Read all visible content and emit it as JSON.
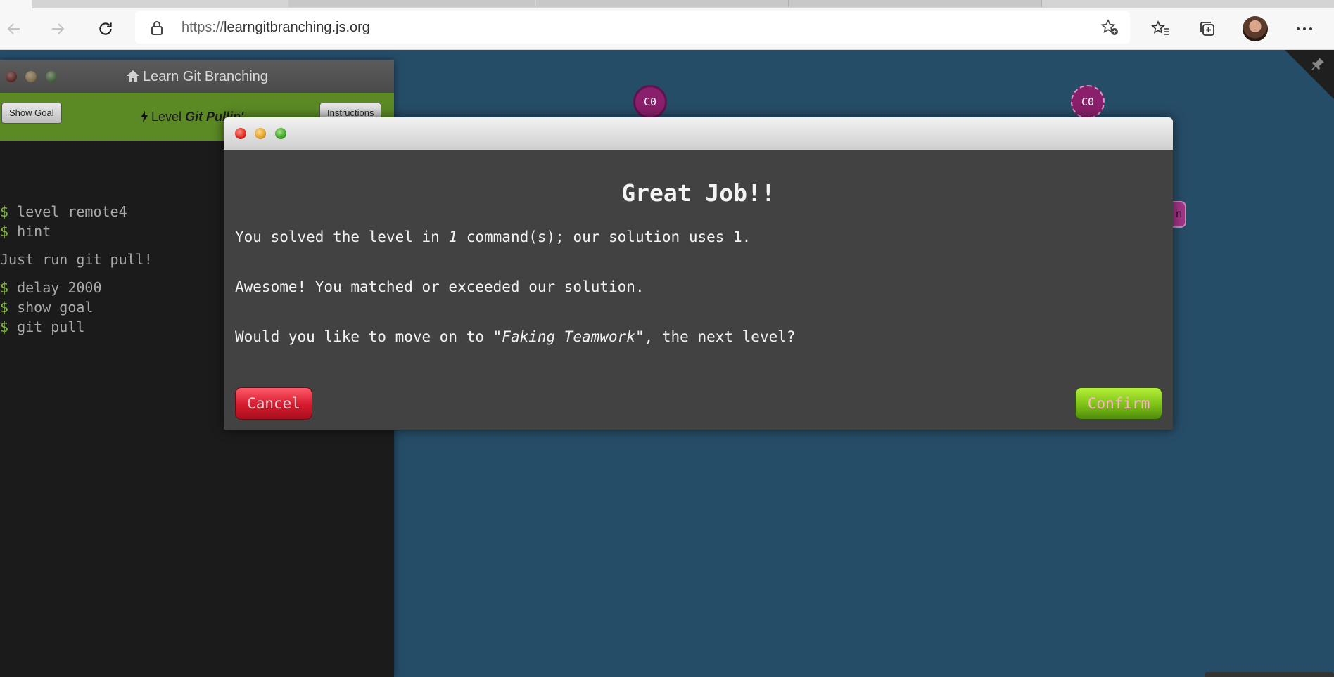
{
  "browser": {
    "url_protocol": "https://",
    "url_host": "learngitbranching.js.org"
  },
  "icons": {
    "back": "arrow-left-icon",
    "forward": "arrow-right-icon",
    "refresh": "refresh-icon",
    "lock": "lock-icon",
    "add_favorite": "star-plus-icon",
    "favorites": "star-list-icon",
    "collections": "collections-icon",
    "more": "ellipsis-icon"
  },
  "terminal": {
    "title": "Learn Git Branching",
    "show_goal_label": "Show Goal",
    "level_prefix": "Level ",
    "level_name": "Git Pullin'",
    "instructions_label": "Instructions",
    "lines": [
      {
        "prompt": "$",
        "text": " level remote4"
      },
      {
        "prompt": "$",
        "text": " hint"
      },
      {
        "prompt": "",
        "text": "Just run git pull!"
      },
      {
        "prompt": "$",
        "text": " delay 2000"
      },
      {
        "prompt": "$",
        "text": " show goal"
      },
      {
        "prompt": "$",
        "text": " git pull"
      }
    ]
  },
  "graph": {
    "commits": [
      {
        "label": "C0",
        "style": "solid"
      },
      {
        "label": "C0",
        "style": "dashed"
      }
    ],
    "partial_tag": "n"
  },
  "modal": {
    "heading": "Great Job!!",
    "line1_prefix": "You solved the level in ",
    "line1_count": "1",
    "line1_suffix": " command(s); our solution uses 1.",
    "line2": "Awesome! You matched or exceeded our solution.",
    "line3_prefix": "Would you like to move on to ",
    "line3_level": "\"Faking Teamwork\"",
    "line3_suffix": ", the next level?",
    "cancel_label": "Cancel",
    "confirm_label": "Confirm"
  },
  "colors": {
    "canvas_bg": "#264d68",
    "level_bar": "#5b8a24",
    "commit_fill": "#8a1f6b",
    "cancel": "#d41a2c",
    "confirm": "#7cc116"
  }
}
